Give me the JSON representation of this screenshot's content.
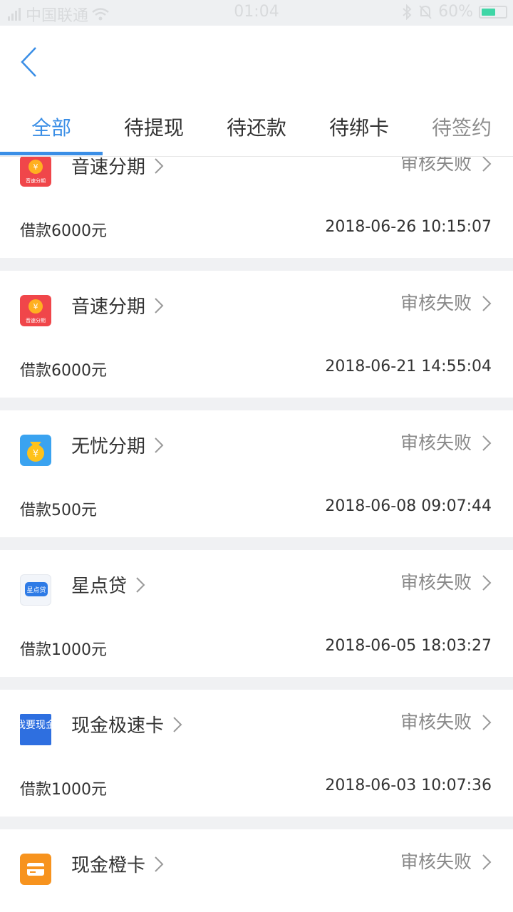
{
  "status_bar": {
    "carrier": "中国联通",
    "time": "01:04",
    "battery": "60%",
    "battery_level": 0.6
  },
  "tabs": [
    {
      "label": "全部"
    },
    {
      "label": "待提现"
    },
    {
      "label": "待还款"
    },
    {
      "label": "待绑卡"
    },
    {
      "label": "待签约"
    }
  ],
  "orders": [
    {
      "name": "音速分期",
      "logo_text": "音速分期",
      "status": "审核失败",
      "amount": "借款6000元",
      "time": "2018-06-26 10:15:07"
    },
    {
      "name": "音速分期",
      "logo_text": "音速分期",
      "status": "审核失败",
      "amount": "借款6000元",
      "time": "2018-06-21 14:55:04"
    },
    {
      "name": "无忧分期",
      "status": "审核失败",
      "amount": "借款500元",
      "time": "2018-06-08 09:07:44"
    },
    {
      "name": "星点贷",
      "logo_text": "星点贷",
      "status": "审核失败",
      "amount": "借款1000元",
      "time": "2018-06-05 18:03:27"
    },
    {
      "name": "现金极速卡",
      "logo_text": "我要现金",
      "status": "审核失败",
      "amount": "借款1000元",
      "time": "2018-06-03 10:07:36"
    },
    {
      "name": "现金橙卡",
      "status": "审核失败",
      "amount": "",
      "time": ""
    }
  ]
}
